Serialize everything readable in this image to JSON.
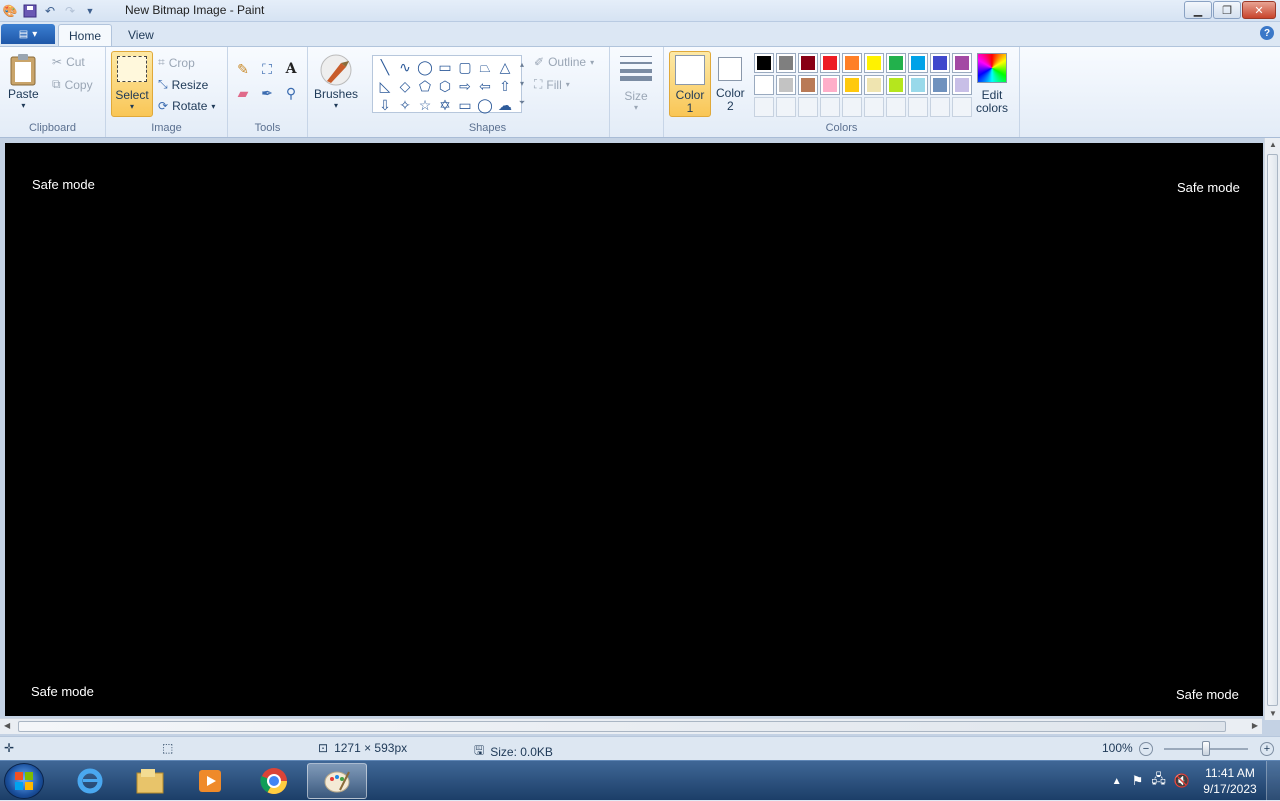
{
  "window": {
    "title": "New Bitmap Image - Paint"
  },
  "tabs": [
    {
      "label": "Home"
    },
    {
      "label": "View"
    }
  ],
  "clipboard": {
    "paste": "Paste",
    "cut": "Cut",
    "copy": "Copy",
    "group": "Clipboard"
  },
  "image": {
    "select": "Select",
    "crop": "Crop",
    "resize": "Resize",
    "rotate": "Rotate",
    "group": "Image"
  },
  "tools": {
    "group": "Tools"
  },
  "brushes": {
    "label": "Brushes"
  },
  "shapes": {
    "outline": "Outline",
    "fill": "Fill",
    "group": "Shapes"
  },
  "size": {
    "label": "Size"
  },
  "colors": {
    "color1_a": "Color",
    "color1_b": "1",
    "color2_a": "Color",
    "color2_b": "2",
    "edit_a": "Edit",
    "edit_b": "colors",
    "group": "Colors",
    "palette_row1": [
      "#000000",
      "#7f7f7f",
      "#880015",
      "#ed1c24",
      "#ff7f27",
      "#fff200",
      "#22b14c",
      "#00a2e8",
      "#3f48cc",
      "#a349a4"
    ],
    "palette_row2": [
      "#ffffff",
      "#c3c3c3",
      "#b97a57",
      "#ffaec9",
      "#ffc90e",
      "#efe4b0",
      "#b5e61d",
      "#99d9ea",
      "#7092be",
      "#c8bfe7"
    ]
  },
  "canvas": {
    "tl": "Safe mode",
    "tr": "Safe mode",
    "bl": "Safe mode",
    "br": "Safe mode"
  },
  "status": {
    "dimensions": "1271 × 593px",
    "size": "Size: 0.0KB",
    "zoom": "100%"
  },
  "taskbar": {
    "time": "11:41 AM",
    "date": "9/17/2023"
  }
}
